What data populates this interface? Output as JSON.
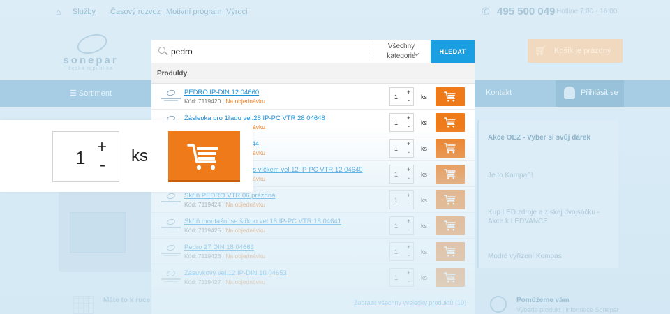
{
  "colors": {
    "accent_orange": "#ef7a1a",
    "search_blue": "#1aa0e2",
    "link_blue": "#1a90d8",
    "background": "#d7ebf6"
  },
  "background_site": {
    "top_links": [
      "Služby",
      "Časový rozvoz",
      "Motivní program",
      "Výroci"
    ],
    "phone": "495 500 049",
    "hours": "Hotline 7:00 - 16:00",
    "logo_brand": "sonepar",
    "logo_sub": "česká republika",
    "cart_button": "Košík je prázdný",
    "nav_menu": "Sortiment",
    "nav_kontakt": "Kontakt",
    "nav_login": "Přihlásit se",
    "side_items": [
      "Akce OEZ - Vyber si svůj dárek",
      "Je to Kampaň!",
      "Kup LED zdroje a získej dvojsáčku - Akce k LEDVANCE",
      "Modré vyřízení Kompas"
    ],
    "bottom_left": "Máte to k ruce",
    "bottom_right_title": "Pomůžeme vám",
    "bottom_right_text": "Vyberte produkt | informace Sonepar"
  },
  "search": {
    "query": "pedro",
    "category_line1": "Všechny",
    "category_line2": "kategorie",
    "button_label": "HLEDAT",
    "results_heading": "Produkty",
    "more_link": "Zobrazit všechny výsledky produktů (10)"
  },
  "products": [
    {
      "name": "PEDRO IP-DIN 12 04660",
      "code_label": "Kód: 7119420",
      "availability": "Na objednávku",
      "qty": "1",
      "unit": "ks"
    },
    {
      "name": "Záslepka pro 1řadu vel.28 IP-PC VTR 28 04648",
      "code_label": "Kód: 7119421",
      "availability": "Na objednávku",
      "qty": "1",
      "unit": "ks"
    },
    {
      "name": "PEDRO IP-DIN 18 04644",
      "code_label": "Kód: 7119422",
      "availability": "Na objednávku",
      "qty": "1",
      "unit": "ks"
    },
    {
      "name": "Skříň PEDRO prázdná s víčkem vel.12 IP-PC VTR 12 04640",
      "code_label": "Kód: 7119423",
      "availability": "Na objednávku",
      "qty": "1",
      "unit": "ks"
    },
    {
      "name": "Skříň PEDRO VTR 06 prázdná",
      "code_label": "Kód: 7119424",
      "availability": "Na objednávku",
      "qty": "1",
      "unit": "ks"
    },
    {
      "name": "Skříň montážní se šířkou vel.18 IP-PC VTR 18 04641",
      "code_label": "Kód: 7119425",
      "availability": "Na objednávku",
      "qty": "1",
      "unit": "ks"
    },
    {
      "name": "Pedro 27 DIN 18 04663",
      "code_label": "Kód: 7119426",
      "availability": "Na objednávku",
      "qty": "1",
      "unit": "ks"
    },
    {
      "name": "Zásuvkový vel.12 IP-DIN 10 04653",
      "code_label": "Kód: 7119427",
      "availability": "Na objednávku",
      "qty": "1",
      "unit": "ks"
    }
  ],
  "zoom": {
    "qty": "1",
    "plus": "+",
    "minus": "-",
    "unit": "ks"
  },
  "icons": {
    "search": "search-icon",
    "cart": "cart-icon",
    "home": "home-icon",
    "phone": "phone-icon",
    "user": "user-icon",
    "chevron": "chevron-down-icon"
  }
}
